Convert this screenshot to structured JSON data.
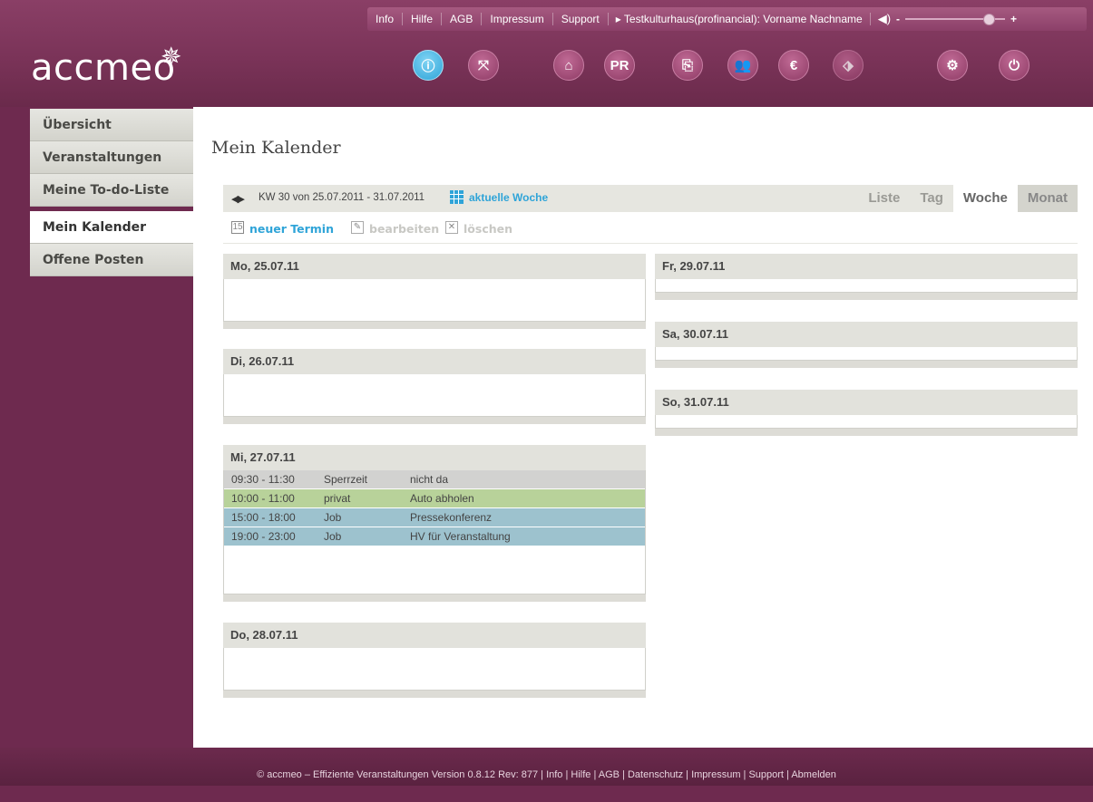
{
  "topbar": {
    "links": [
      "Info",
      "Hilfe",
      "AGB",
      "Impressum",
      "Support"
    ],
    "user": "▸ Testkulturhaus(profinancial): Vorname Nachname",
    "volume_minus": "-",
    "volume_plus": "+",
    "volume_level": 0.92
  },
  "logo": {
    "text": "accmeo"
  },
  "nav_icons": [
    {
      "name": "info-icon",
      "glyph": "ⓘ",
      "active": true
    },
    {
      "name": "arrows-icon",
      "glyph": "⤧"
    },
    {
      "name": "home-icon",
      "glyph": "⌂"
    },
    {
      "name": "pr-icon",
      "glyph": "PR"
    },
    {
      "name": "paperclip-icon",
      "glyph": "⎘"
    },
    {
      "name": "people-icon",
      "glyph": "👥"
    },
    {
      "name": "euro-icon",
      "glyph": "€"
    },
    {
      "name": "tag-icon",
      "glyph": "⬗",
      "dim": true
    },
    {
      "name": "settings-icon",
      "glyph": "⚙"
    },
    {
      "name": "power-icon",
      "glyph": "⏻"
    }
  ],
  "sidebar": {
    "items": [
      "Übersicht",
      "Veranstaltungen",
      "Meine To-do-Liste",
      "Mein Kalender",
      "Offene Posten"
    ],
    "active": "Mein Kalender"
  },
  "main": {
    "title": "Mein Kalender",
    "toolbar": {
      "week": "KW 30 von 25.07.2011 - 31.07.2011",
      "current_week": "aktuelle Woche",
      "views": [
        "Liste",
        "Tag",
        "Woche",
        "Monat"
      ],
      "active_view": "Woche"
    },
    "actions": {
      "new": "neuer Termin",
      "edit": "bearbeiten",
      "delete": "löschen"
    },
    "days": {
      "mo": {
        "title": "Mo, 25.07.11"
      },
      "di": {
        "title": "Di, 26.07.11"
      },
      "mi": {
        "title": "Mi, 27.07.11",
        "events": [
          {
            "time": "09:30 - 11:30",
            "category": "Sperrzeit",
            "title": "nicht da",
            "color": "#d2d2d0"
          },
          {
            "time": "10:00 - 11:00",
            "category": "privat",
            "title": "Auto abholen",
            "color": "#b8d29a"
          },
          {
            "time": "15:00 - 18:00",
            "category": "Job",
            "title": "Pressekonferenz",
            "color": "#9dc2ce"
          },
          {
            "time": "19:00 - 23:00",
            "category": "Job",
            "title": "HV für Veranstaltung",
            "color": "#9dc2ce"
          }
        ]
      },
      "do": {
        "title": "Do, 28.07.11"
      },
      "fr": {
        "title": "Fr, 29.07.11"
      },
      "sa": {
        "title": "Sa, 30.07.11"
      },
      "so": {
        "title": "So, 31.07.11"
      }
    }
  },
  "footer": {
    "text": "© accmeo – Effiziente Veranstaltungen Version 0.8.12 Rev: 877 | Info | Hilfe | AGB | Datenschutz | Impressum | Support | Abmelden"
  },
  "colors": {
    "brand": "#7a3358",
    "accent": "#2fa4d8"
  }
}
